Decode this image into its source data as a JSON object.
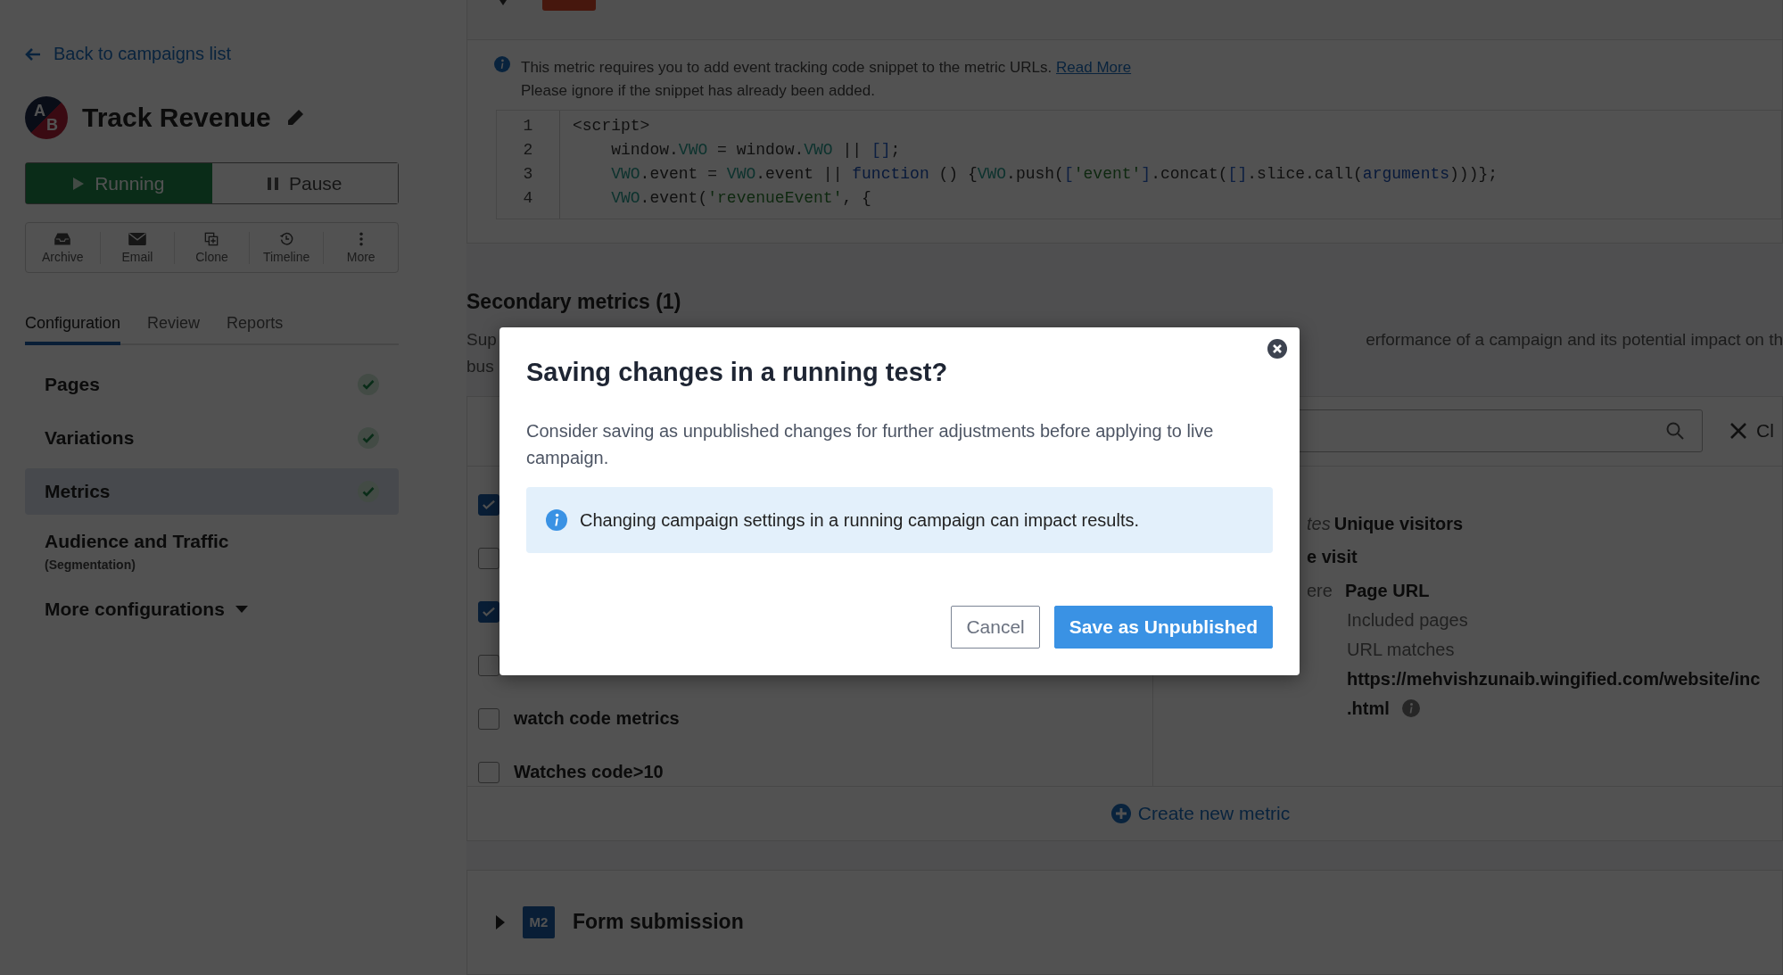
{
  "sidebar": {
    "back_link": "Back to campaigns list",
    "campaign": {
      "avatar_letters": [
        "A",
        "B"
      ],
      "title": "Track Revenue"
    },
    "status_toggle": [
      {
        "label": "Running",
        "kind": "play",
        "selected": true
      },
      {
        "label": "Pause",
        "kind": "pause",
        "selected": false
      }
    ],
    "actions": [
      {
        "label": "Archive",
        "kind": "archive"
      },
      {
        "label": "Email",
        "kind": "email"
      },
      {
        "label": "Clone",
        "kind": "clone"
      },
      {
        "label": "Timeline",
        "kind": "timeline"
      },
      {
        "label": "More",
        "kind": "more"
      }
    ],
    "tabs": [
      {
        "label": "Configuration",
        "selected": true
      },
      {
        "label": "Review",
        "selected": false
      },
      {
        "label": "Reports",
        "selected": false
      }
    ],
    "nav": [
      {
        "label": "Pages",
        "done": true,
        "selected": false
      },
      {
        "label": "Variations",
        "done": true,
        "selected": false
      },
      {
        "label": "Metrics",
        "done": true,
        "selected": false,
        "current": true
      },
      {
        "label": "Audience and Traffic",
        "sublabel": "(Segmentation)",
        "done": false,
        "selected": false
      }
    ],
    "more_configurations": "More configurations"
  },
  "primary_metric": {
    "notice": "This metric requires you to add event tracking code snippet to the metric URLs.",
    "notice_link": "Read More",
    "notice_note": "Please ignore if the snippet has already been added.",
    "code": [
      [
        {
          "text": "<script>",
          "kind": "plain"
        }
      ],
      [
        {
          "text": "window.",
          "kind": "plain"
        },
        {
          "text": "VWO",
          "kind": "ident"
        },
        {
          "text": " = window.",
          "kind": "plain"
        },
        {
          "text": "VWO",
          "kind": "ident"
        },
        {
          "text": " || ",
          "kind": "plain"
        },
        {
          "text": "[]",
          "kind": "bracket"
        },
        {
          "text": ";",
          "kind": "plain"
        }
      ],
      [
        {
          "text": "VWO",
          "kind": "ident"
        },
        {
          "text": ".event = ",
          "kind": "plain"
        },
        {
          "text": "VWO",
          "kind": "ident"
        },
        {
          "text": ".event || ",
          "kind": "plain"
        },
        {
          "text": "function",
          "kind": "keyword"
        },
        {
          "text": " () {",
          "kind": "plain"
        },
        {
          "text": "VWO",
          "kind": "ident"
        },
        {
          "text": ".push(",
          "kind": "plain"
        },
        {
          "text": "[",
          "kind": "bracket"
        },
        {
          "text": "'event'",
          "kind": "string"
        },
        {
          "text": "]",
          "kind": "bracket"
        },
        {
          "text": ".concat(",
          "kind": "plain"
        },
        {
          "text": "[]",
          "kind": "bracket"
        },
        {
          "text": ".slice.call(",
          "kind": "plain"
        },
        {
          "text": "arguments",
          "kind": "keyword"
        },
        {
          "text": ")))};",
          "kind": "plain"
        }
      ],
      [
        {
          "text": "VWO",
          "kind": "ident"
        },
        {
          "text": ".event(",
          "kind": "plain"
        },
        {
          "text": "'revenueEvent'",
          "kind": "string"
        },
        {
          "text": ", {",
          "kind": "plain"
        }
      ]
    ],
    "line_numbers": [
      "1",
      "2",
      "3",
      "4"
    ]
  },
  "secondary_metrics": {
    "title": "Secondary metrics (1)",
    "description_left": [
      "Sup",
      "bus"
    ],
    "description_right": "erformance of a campaign and its potential impact on th",
    "clear_label": "Cl",
    "metrics": [
      {
        "checked": true
      },
      {
        "checked": false
      },
      {
        "checked": true
      },
      {
        "checked": false
      },
      {
        "label": "watch code metrics",
        "checked": false
      },
      {
        "label": "Watches code>10",
        "checked": false
      }
    ],
    "details": {
      "counts_prefix": "tes",
      "counts_value": "Unique visitors",
      "event_tail": "e visit",
      "where_label": "ere",
      "where_value": "Page URL",
      "pages_label": "Included pages",
      "match_label": "URL matches",
      "url": "https://mehvishzunaib.wingified.com/website/inc",
      "url_tail": ".html"
    },
    "create_link": "Create new metric"
  },
  "next_metric": {
    "badge": "M2",
    "title": "Form submission"
  },
  "dialog": {
    "title": "Saving changes in a running test?",
    "body": "Consider saving as unpublished changes for further adjustments before applying to live campaign.",
    "alert": "Changing campaign settings in a running campaign can impact results.",
    "buttons": [
      {
        "label": "Cancel",
        "kind": "secondary"
      },
      {
        "label": "Save as Unpublished",
        "kind": "primary"
      }
    ]
  }
}
